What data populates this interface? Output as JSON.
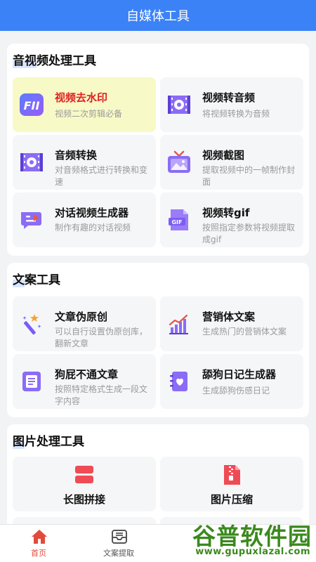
{
  "header": {
    "title": "自媒体工具"
  },
  "sections": [
    {
      "title_hl": "音视",
      "title_rest": "频处理工具",
      "cards": [
        {
          "title": "视频去水印",
          "desc": "视频二次剪辑必备",
          "icon": "watermark-remove-icon",
          "active": true
        },
        {
          "title": "视频转音频",
          "desc": "将视频转换为音频",
          "icon": "video-to-audio-icon"
        },
        {
          "title": "音频转换",
          "desc": "对音频格式进行转换和变速",
          "icon": "audio-convert-icon"
        },
        {
          "title": "视频截图",
          "desc": "提取视频中的一帧制作封面",
          "icon": "tv-screenshot-icon"
        },
        {
          "title": "对话视频生成器",
          "desc": "制作有趣的对话视频",
          "icon": "chat-video-icon"
        },
        {
          "title": "视频转gif",
          "desc": "按照指定参数将视频提取成gif",
          "icon": "gif-icon"
        }
      ]
    },
    {
      "title_hl": "文",
      "title_rest": "案工具",
      "cards": [
        {
          "title": "文章伪原创",
          "desc": "可以自行设置伪原创库，翻新文章",
          "icon": "magic-wand-icon"
        },
        {
          "title": "营销体文案",
          "desc": "生成热门的营销体文案",
          "icon": "bar-chart-icon"
        },
        {
          "title": "狗屁不通文章",
          "desc": "按照特定格式生成一段文字内容",
          "icon": "document-icon"
        },
        {
          "title": "舔狗日记生成器",
          "desc": "生成舔狗伤感日记",
          "icon": "heart-diary-icon"
        }
      ]
    },
    {
      "title_hl": "图",
      "title_rest": "片处理工具",
      "cards": [
        {
          "title": "长图拼接",
          "icon": "image-stitch-icon"
        },
        {
          "title": "图片压缩",
          "icon": "zip-file-icon"
        }
      ]
    }
  ],
  "tabs": [
    {
      "label": "首页",
      "icon": "home-icon",
      "active": true
    },
    {
      "label": "文案提取",
      "icon": "inbox-icon",
      "active": false
    }
  ],
  "watermark": {
    "text": "谷普软件园",
    "url": "www.gupuxlazal.com"
  },
  "colors": {
    "header": "#3b82f6",
    "active_card": "#f7f9c7",
    "active_title": "#e02020",
    "tab_active": "#e24b3b",
    "icon_purple": "#7b5cf5"
  }
}
